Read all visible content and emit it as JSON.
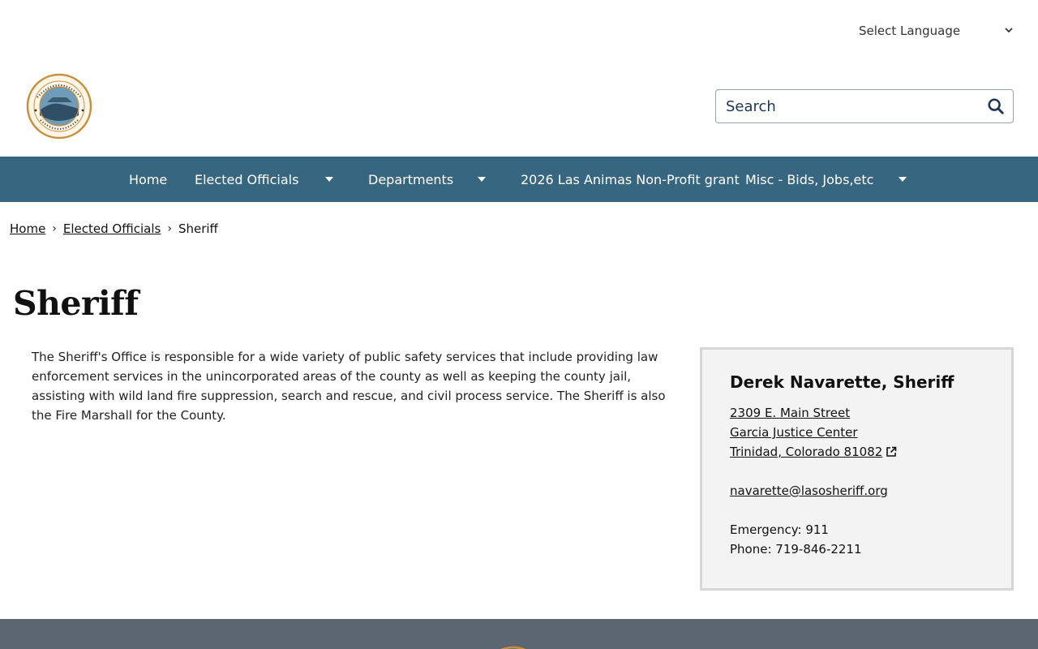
{
  "language": {
    "label": "Select Language"
  },
  "search": {
    "placeholder": "Search"
  },
  "nav": {
    "items": [
      {
        "label": "Home"
      },
      {
        "label": "Elected Officials"
      },
      {
        "label": "Departments"
      },
      {
        "label": "2026 Las Animas Non-Profit grant"
      },
      {
        "label": "Misc - Bids, Jobs,etc"
      }
    ]
  },
  "breadcrumb": {
    "items": [
      "Home",
      "Elected Officials",
      "Sheriff"
    ]
  },
  "page": {
    "title": "Sheriff",
    "intro": "The Sheriff's Office is responsible for a wide variety of public safety services that include providing law enforcement services in the unincorporated areas of the county as well as keeping the county jail, assisting with wild land fire suppression, search and rescue, and civil process service. The Sheriff is also the Fire Marshall for the County."
  },
  "contact": {
    "name": "Derek Navarette, Sheriff",
    "address1": "2309 E. Main Street",
    "address2": "Garcia Justice Center",
    "address3": "Trinidad, Colorado 81082",
    "email": "navarette@lasosheriff.org",
    "emergency": "Emergency: 911",
    "phone": "Phone: 719-846-2211"
  },
  "colors": {
    "nav_bg": "#376681",
    "footer_bg": "#5c6670",
    "card_bg": "#f3f3f3"
  }
}
